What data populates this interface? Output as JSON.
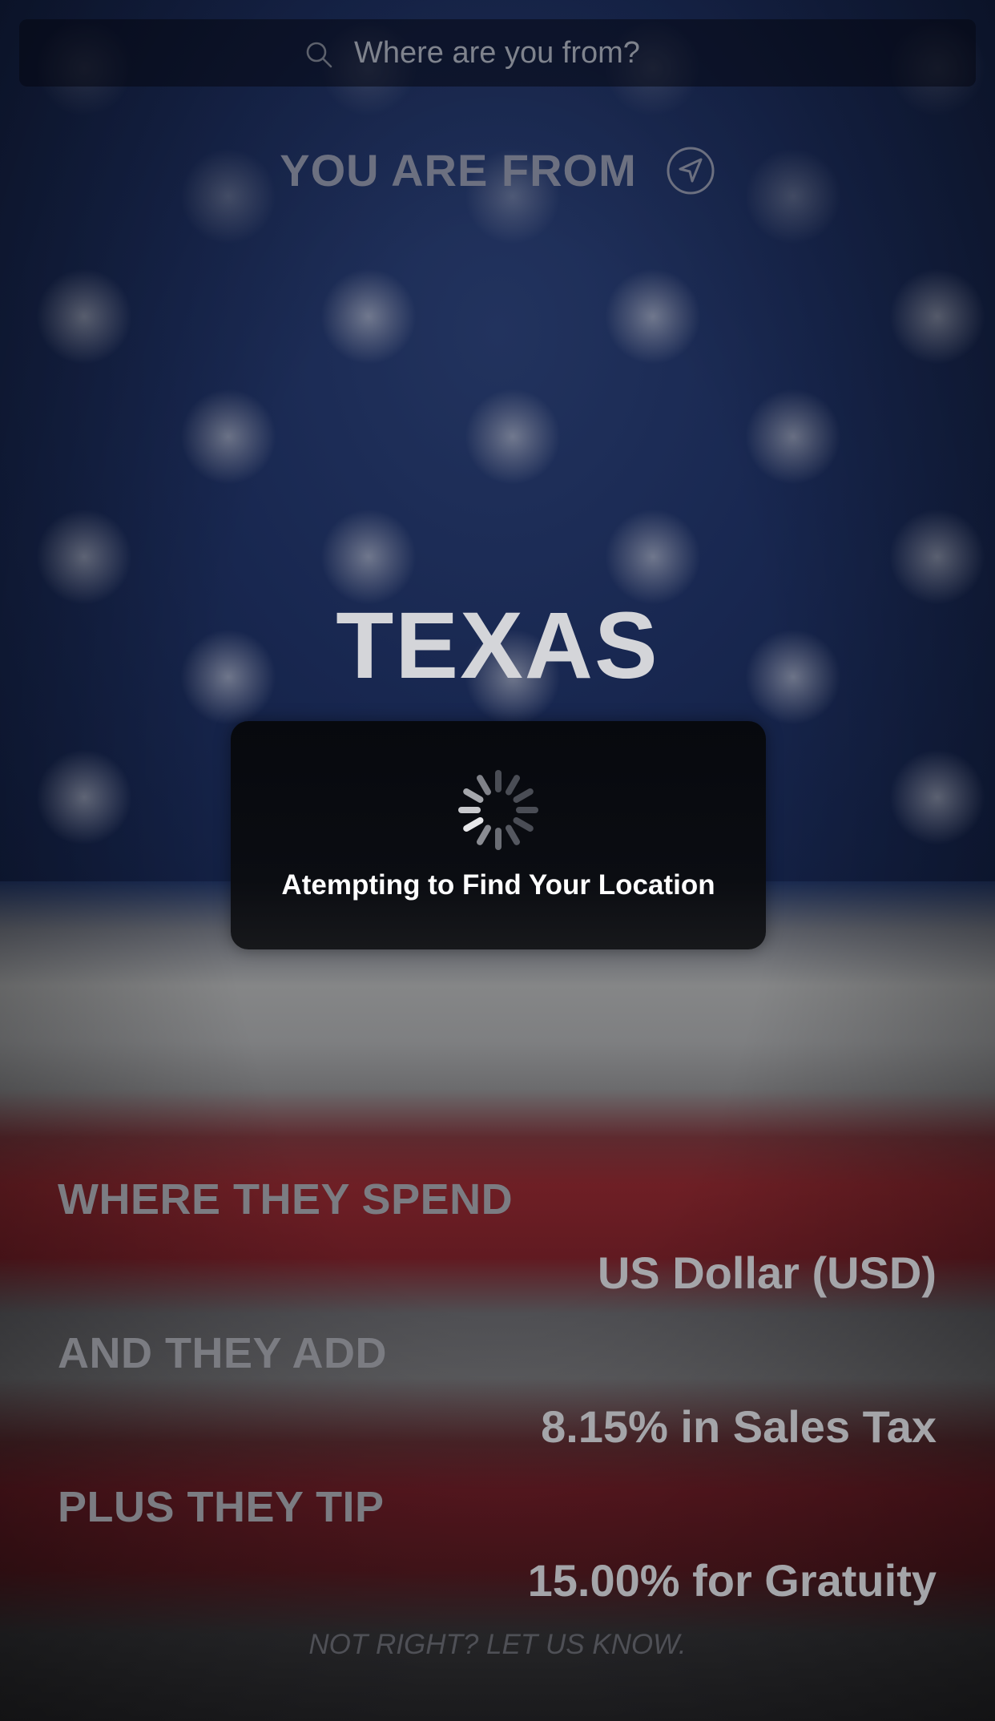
{
  "search": {
    "placeholder": "Where are you from?"
  },
  "header": {
    "label": "YOU ARE FROM"
  },
  "location": {
    "name": "TEXAS"
  },
  "hud": {
    "message": "Atempting to Find Your Location"
  },
  "details": [
    {
      "label": "WHERE THEY SPEND",
      "value": "US Dollar (USD)"
    },
    {
      "label": "AND THEY ADD",
      "value": "8.15% in Sales Tax"
    },
    {
      "label": "PLUS THEY TIP",
      "value": "15.00% for Gratuity"
    }
  ],
  "footer": {
    "feedback_link": "NOT RIGHT? LET US KNOW."
  },
  "colors": {
    "flag_blue": "#182750",
    "flag_red": "#6e1f25",
    "flag_white": "#858687"
  }
}
